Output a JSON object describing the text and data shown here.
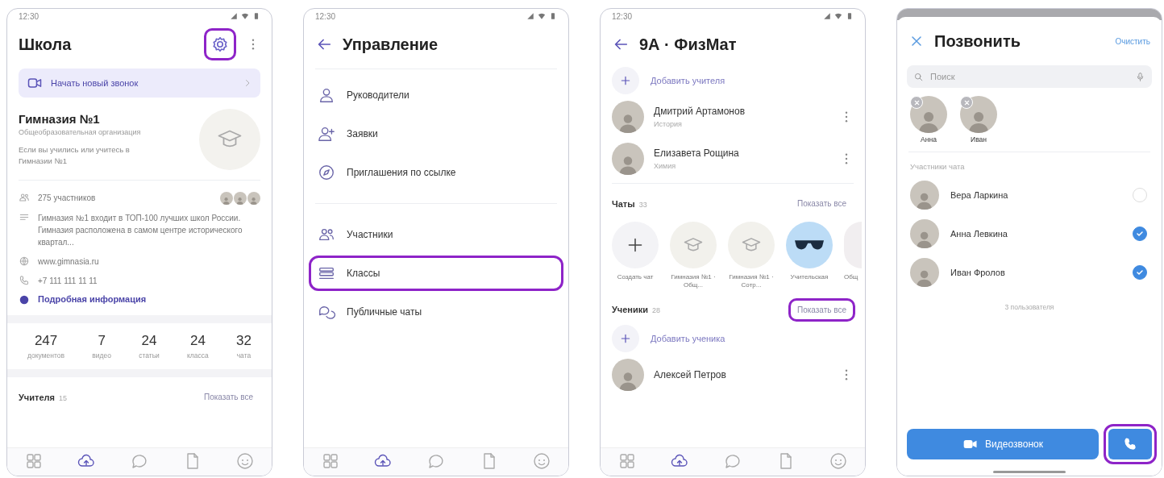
{
  "screens": [
    {
      "kind": "school",
      "status_time": "12:30",
      "title": "Школа",
      "settings_highlighted": true,
      "banner": "Начать новый звонок",
      "org": {
        "name": "Гимназия №1",
        "type": "Общеобразовательная организация",
        "note": "Если вы учились или учитесь в Гимназии №1"
      },
      "members": "275 участников",
      "description": "Гимназия №1 входит в ТОП-100 лучших школ России. Гимназия расположена в самом центре исторического квартал...",
      "website": "www.gimnasia.ru",
      "phone": "+7 111 111 11 11",
      "details_link": "Подробная информация",
      "stats": [
        {
          "value": "247",
          "label": "документов"
        },
        {
          "value": "7",
          "label": "видео"
        },
        {
          "value": "24",
          "label": "статьи"
        },
        {
          "value": "24",
          "label": "класса"
        },
        {
          "value": "32",
          "label": "чата"
        }
      ],
      "section": {
        "title": "Учителя",
        "count": "15",
        "action": "Показать все"
      },
      "nav": [
        {
          "selected": false
        },
        {
          "selected": true
        },
        {
          "selected": false
        },
        {
          "selected": false
        },
        {
          "selected": false
        }
      ]
    },
    {
      "kind": "management",
      "status_time": "12:30",
      "title": "Управление",
      "groups": [
        {
          "items": [
            {
              "label": "Руководители",
              "highlighted": false
            },
            {
              "label": "Заявки",
              "highlighted": false
            },
            {
              "label": "Приглашения по ссылке",
              "highlighted": false
            }
          ]
        },
        {
          "items": [
            {
              "label": "Участники",
              "highlighted": false
            },
            {
              "label": "Классы",
              "highlighted": true
            },
            {
              "label": "Публичные чаты",
              "highlighted": false
            }
          ]
        }
      ],
      "nav": [
        {
          "selected": false
        },
        {
          "selected": true
        },
        {
          "selected": false
        },
        {
          "selected": false
        },
        {
          "selected": false
        }
      ]
    },
    {
      "kind": "class",
      "status_time": "12:30",
      "title": "9А · ФизМат",
      "add_teacher": "Добавить учителя",
      "teachers": [
        {
          "name": "Дмитрий Артамонов",
          "subject": "История"
        },
        {
          "name": "Елизавета Рощина",
          "subject": "Химия"
        }
      ],
      "chats_section": {
        "title": "Чаты",
        "count": "33",
        "action": "Показать все",
        "highlighted": false
      },
      "chats": [
        {
          "kind": "create",
          "label": "Создать чат"
        },
        {
          "kind": "org",
          "label": "Гимназия №1 · Общ..."
        },
        {
          "kind": "org",
          "label": "Гимназия №1 · Сотр..."
        },
        {
          "kind": "glasses",
          "label": "Учительская"
        },
        {
          "kind": "partial",
          "label": "Общ"
        }
      ],
      "students_section": {
        "title": "Ученики",
        "count": "28",
        "action": "Показать все",
        "highlighted": true
      },
      "add_student": "Добавить ученика",
      "students": [
        {
          "name": "Алексей Петров"
        }
      ],
      "nav": [
        {
          "selected": false
        },
        {
          "selected": true
        },
        {
          "selected": false
        },
        {
          "selected": false
        },
        {
          "selected": false
        }
      ]
    },
    {
      "kind": "call",
      "title": "Позвонить",
      "clear": "Очистить",
      "search": {
        "placeholder": "Поиск"
      },
      "selected_chips": [
        {
          "name": "Анна"
        },
        {
          "name": "Иван"
        }
      ],
      "list_title": "Участники чата",
      "participants": [
        {
          "name": "Вера Ларкина",
          "checked": false
        },
        {
          "name": "Анна Левкина",
          "checked": true
        },
        {
          "name": "Иван Фролов",
          "checked": true
        }
      ],
      "footer": "3 пользователя",
      "video_button": "Видеозвонок",
      "call_highlighted": true
    }
  ]
}
